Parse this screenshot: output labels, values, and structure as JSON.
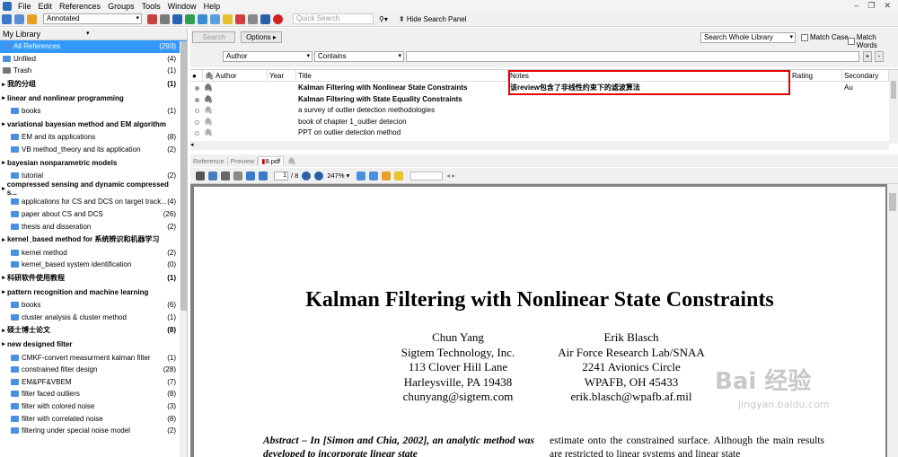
{
  "menubar": {
    "items": [
      "File",
      "Edit",
      "References",
      "Groups",
      "Tools",
      "Window",
      "Help"
    ]
  },
  "toolbar": {
    "library_select": "Annotated",
    "quick_search_placeholder": "Quick Search",
    "hide_search_panel": "Hide Search Panel"
  },
  "sidebar": {
    "header": "My Library",
    "items": [
      {
        "kind": "top",
        "label": "All References",
        "count": "(293)",
        "selected": true
      },
      {
        "kind": "top",
        "label": "Unfiled",
        "count": "(4)"
      },
      {
        "kind": "top",
        "label": "Trash",
        "count": "(1)"
      },
      {
        "kind": "group",
        "label": "我的分组",
        "count": "(1)"
      },
      {
        "kind": "group",
        "label": "linear and nonlinear programming",
        "count": ""
      },
      {
        "kind": "sub",
        "label": "books",
        "count": "(1)"
      },
      {
        "kind": "group",
        "label": "variational bayesian method and EM algorithm",
        "count": ""
      },
      {
        "kind": "sub",
        "label": "EM and its applications",
        "count": "(8)"
      },
      {
        "kind": "sub",
        "label": "VB method_theory and its application",
        "count": "(2)"
      },
      {
        "kind": "group",
        "label": "bayesian nonparametric models",
        "count": ""
      },
      {
        "kind": "sub",
        "label": "tutorial",
        "count": "(2)"
      },
      {
        "kind": "group",
        "label": "compressed sensing and dynamic compressed s...",
        "count": ""
      },
      {
        "kind": "sub",
        "label": "applications for CS and DCS on target track...",
        "count": "(4)"
      },
      {
        "kind": "sub",
        "label": "paper about CS and DCS",
        "count": "(26)"
      },
      {
        "kind": "sub",
        "label": "thesis and disseration",
        "count": "(2)"
      },
      {
        "kind": "group",
        "label": "kernel_based method for 系统辨识和机器学习",
        "count": ""
      },
      {
        "kind": "sub",
        "label": "kernel method",
        "count": "(2)"
      },
      {
        "kind": "sub",
        "label": "kernel_based system identification",
        "count": "(0)"
      },
      {
        "kind": "group",
        "label": "科研软件使用教程",
        "count": "(1)"
      },
      {
        "kind": "group",
        "label": "pattern recognition and machine learning",
        "count": ""
      },
      {
        "kind": "sub",
        "label": "books",
        "count": "(6)"
      },
      {
        "kind": "sub",
        "label": "cluster analysis & cluster method",
        "count": "(1)"
      },
      {
        "kind": "group",
        "label": "硕士博士论文",
        "count": "(8)"
      },
      {
        "kind": "group",
        "label": "new designed filter",
        "count": ""
      },
      {
        "kind": "sub",
        "label": "CMKF-convert measurment kalman filter",
        "count": "(1)"
      },
      {
        "kind": "sub",
        "label": "constrained filter design",
        "count": "(28)"
      },
      {
        "kind": "sub",
        "label": "EM&PF&VBEM",
        "count": "(7)"
      },
      {
        "kind": "sub",
        "label": "filter faced outliers",
        "count": "(8)"
      },
      {
        "kind": "sub",
        "label": "filter with colored noise",
        "count": "(3)"
      },
      {
        "kind": "sub",
        "label": "filter with correlated noise",
        "count": "(8)"
      },
      {
        "kind": "sub",
        "label": "filtering under special noise model",
        "count": "(2)"
      }
    ]
  },
  "search": {
    "search_button": "Search",
    "options_button": "Options",
    "scope": "Search Whole Library",
    "match_case": "Match Case",
    "match_words": "Match Words",
    "field": "Author",
    "operator": "Contains",
    "value": ""
  },
  "table": {
    "columns": [
      "Author",
      "Year",
      "Title",
      "Notes",
      "Rating",
      "Secondary Au"
    ],
    "rows": [
      {
        "title": "Kalman Filtering with Nonlinear State Constraints",
        "notes": "该review包含了非线性约束下的滤波算法",
        "bold": true
      },
      {
        "title": "Kalman Filtering with State Equality Constraints",
        "notes": "",
        "bold": true
      },
      {
        "title": "a survey of outlier detection methodologies",
        "notes": "",
        "bold": false
      },
      {
        "title": "book of chapter 1_outlier detecion",
        "notes": "",
        "bold": false
      },
      {
        "title": "PPT on outlier detection method",
        "notes": "",
        "bold": false
      }
    ]
  },
  "tabs": {
    "reference": "Reference",
    "preview": "Preview",
    "pdf": "8.pdf"
  },
  "pdf_toolbar": {
    "page": "1",
    "total": "/ 8",
    "zoom": "247%"
  },
  "pdf": {
    "title": "Kalman Filtering with Nonlinear State Constraints",
    "author1": [
      "Chun Yang",
      "Sigtem Technology, Inc.",
      "113 Clover Hill Lane",
      "Harleysville, PA 19438",
      "chunyang@sigtem.com"
    ],
    "author2": [
      "Erik Blasch",
      "Air Force Research Lab/SNAA",
      "2241 Avionics Circle",
      "WPAFB, OH 45433",
      "erik.blasch@wpafb.af.mil"
    ],
    "abstract_left": "Abstract – In [Simon and Chia, 2002], an analytic method was developed to incorporate linear state",
    "abstract_right": "estimate onto the constrained surface. Although the main results are restricted to linear systems and linear state"
  },
  "watermark": {
    "text": "Bai 经验",
    "sub": "jingyan.baidu.com"
  }
}
